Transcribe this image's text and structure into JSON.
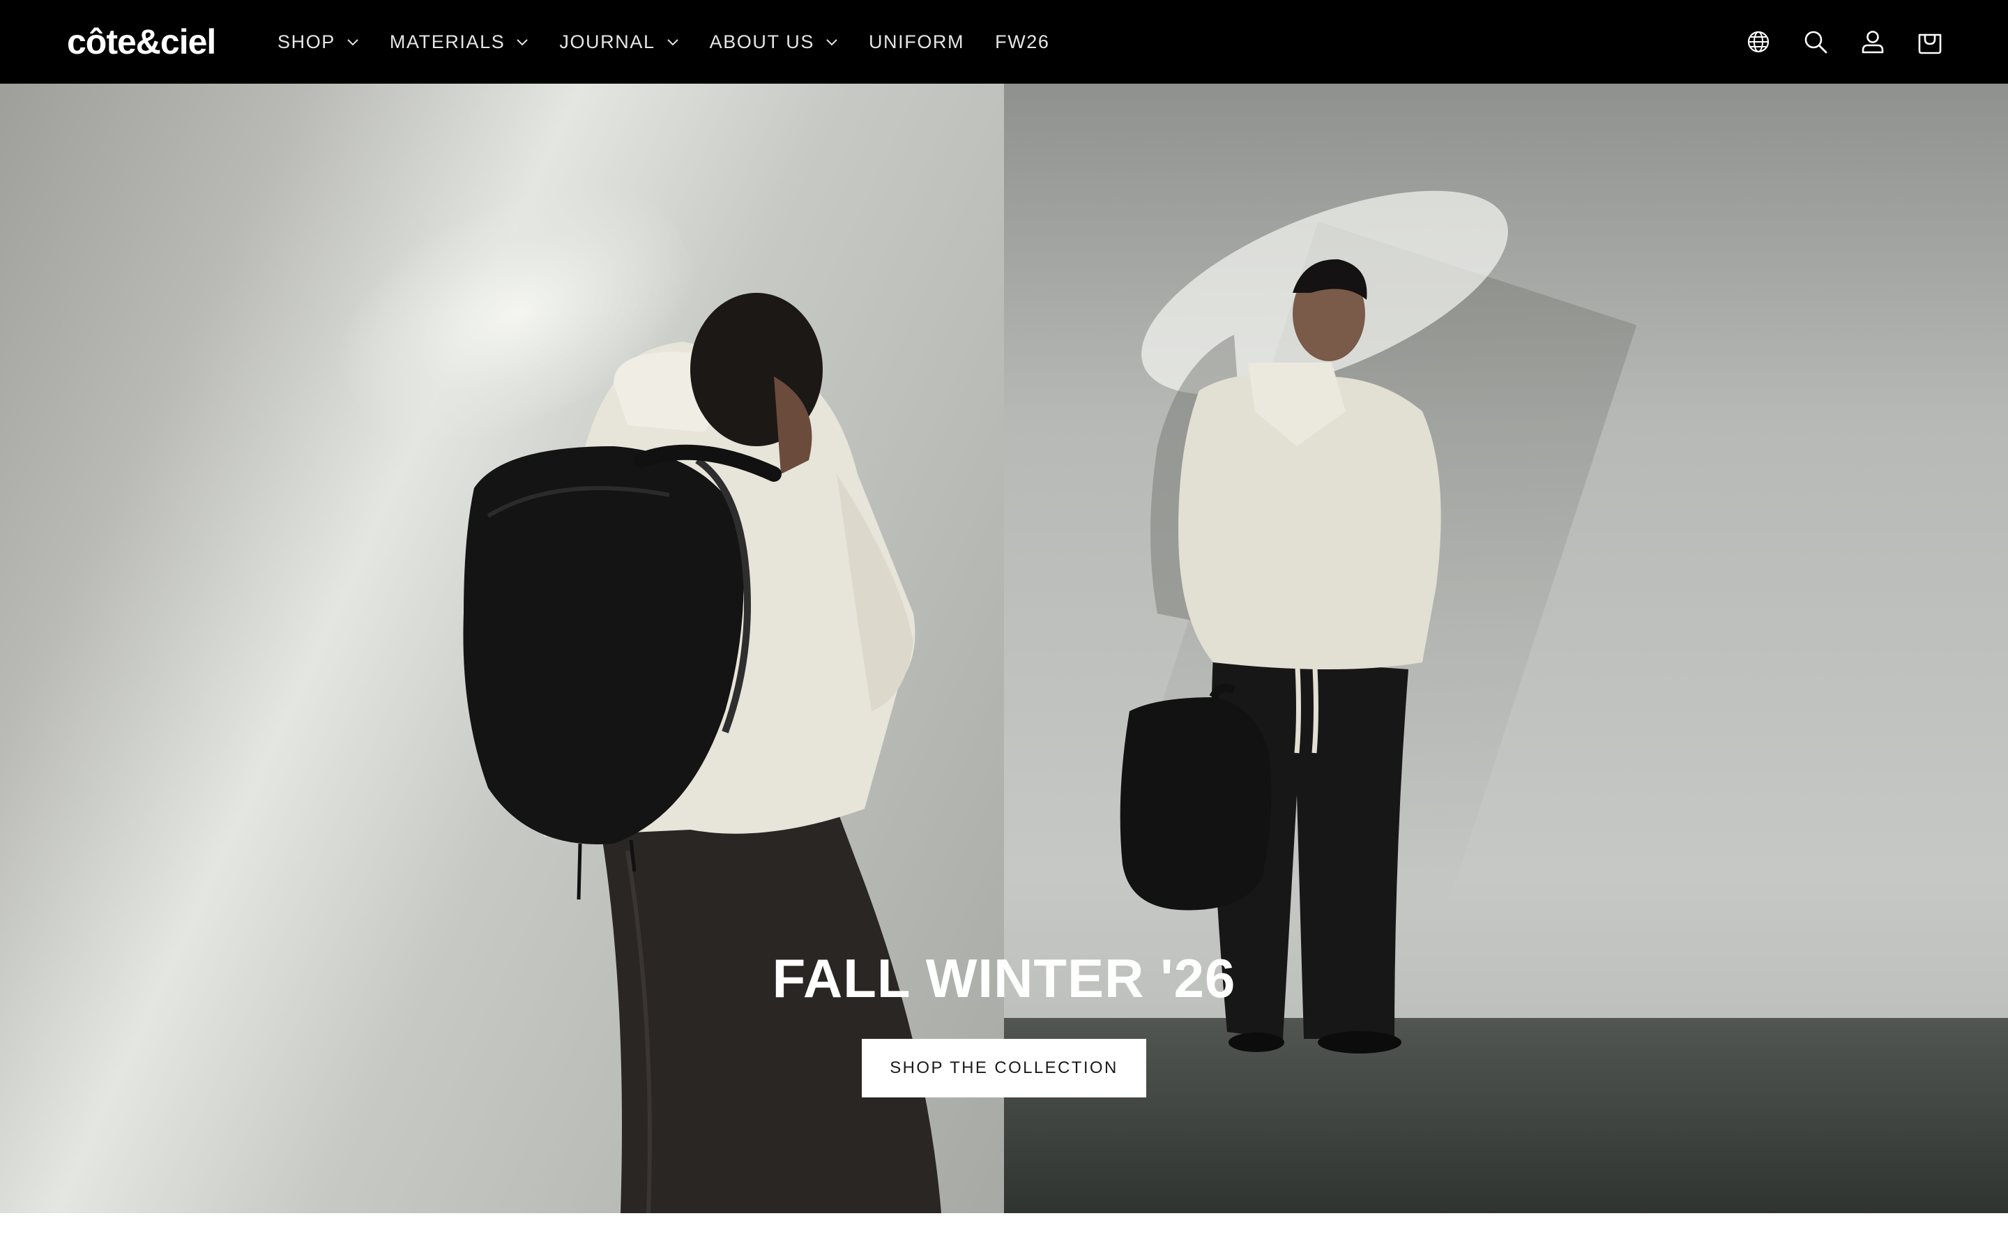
{
  "brand": {
    "logo_text": "côte&ciel"
  },
  "nav": {
    "items": [
      {
        "label": "SHOP",
        "has_dropdown": true
      },
      {
        "label": "MATERIALS",
        "has_dropdown": true
      },
      {
        "label": "JOURNAL",
        "has_dropdown": true
      },
      {
        "label": "ABOUT US",
        "has_dropdown": true
      },
      {
        "label": "UNIFORM",
        "has_dropdown": false
      },
      {
        "label": "FW26",
        "has_dropdown": false
      }
    ]
  },
  "header_icons": [
    "globe-icon",
    "search-icon",
    "account-icon",
    "cart-icon"
  ],
  "hero": {
    "title": "FALL WINTER '26",
    "cta_label": "SHOP THE COLLECTION"
  },
  "colors": {
    "header_bg": "#000000",
    "header_text": "#ffffff",
    "cta_bg": "#ffffff",
    "cta_text": "#1a1a1a"
  }
}
